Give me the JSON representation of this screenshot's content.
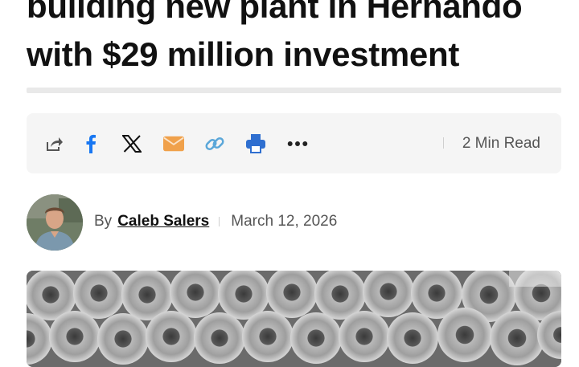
{
  "article": {
    "headline_line1": "building new plant in Hernando",
    "headline_line2": "with $29 million investment"
  },
  "share": {
    "items": [
      {
        "icon": "share-icon"
      },
      {
        "icon": "facebook-icon"
      },
      {
        "icon": "x-icon"
      },
      {
        "icon": "email-icon"
      },
      {
        "icon": "link-icon"
      },
      {
        "icon": "print-icon"
      },
      {
        "icon": "more-icon"
      }
    ],
    "read_time": "2 Min Read",
    "colors": {
      "facebook": "#1877f2",
      "email": "#f0a14b",
      "link": "#5ba7d9",
      "print": "#2f6fd0"
    }
  },
  "byline": {
    "by_label": "By",
    "author": "Caleb Salers",
    "date": "March 12, 2026"
  }
}
